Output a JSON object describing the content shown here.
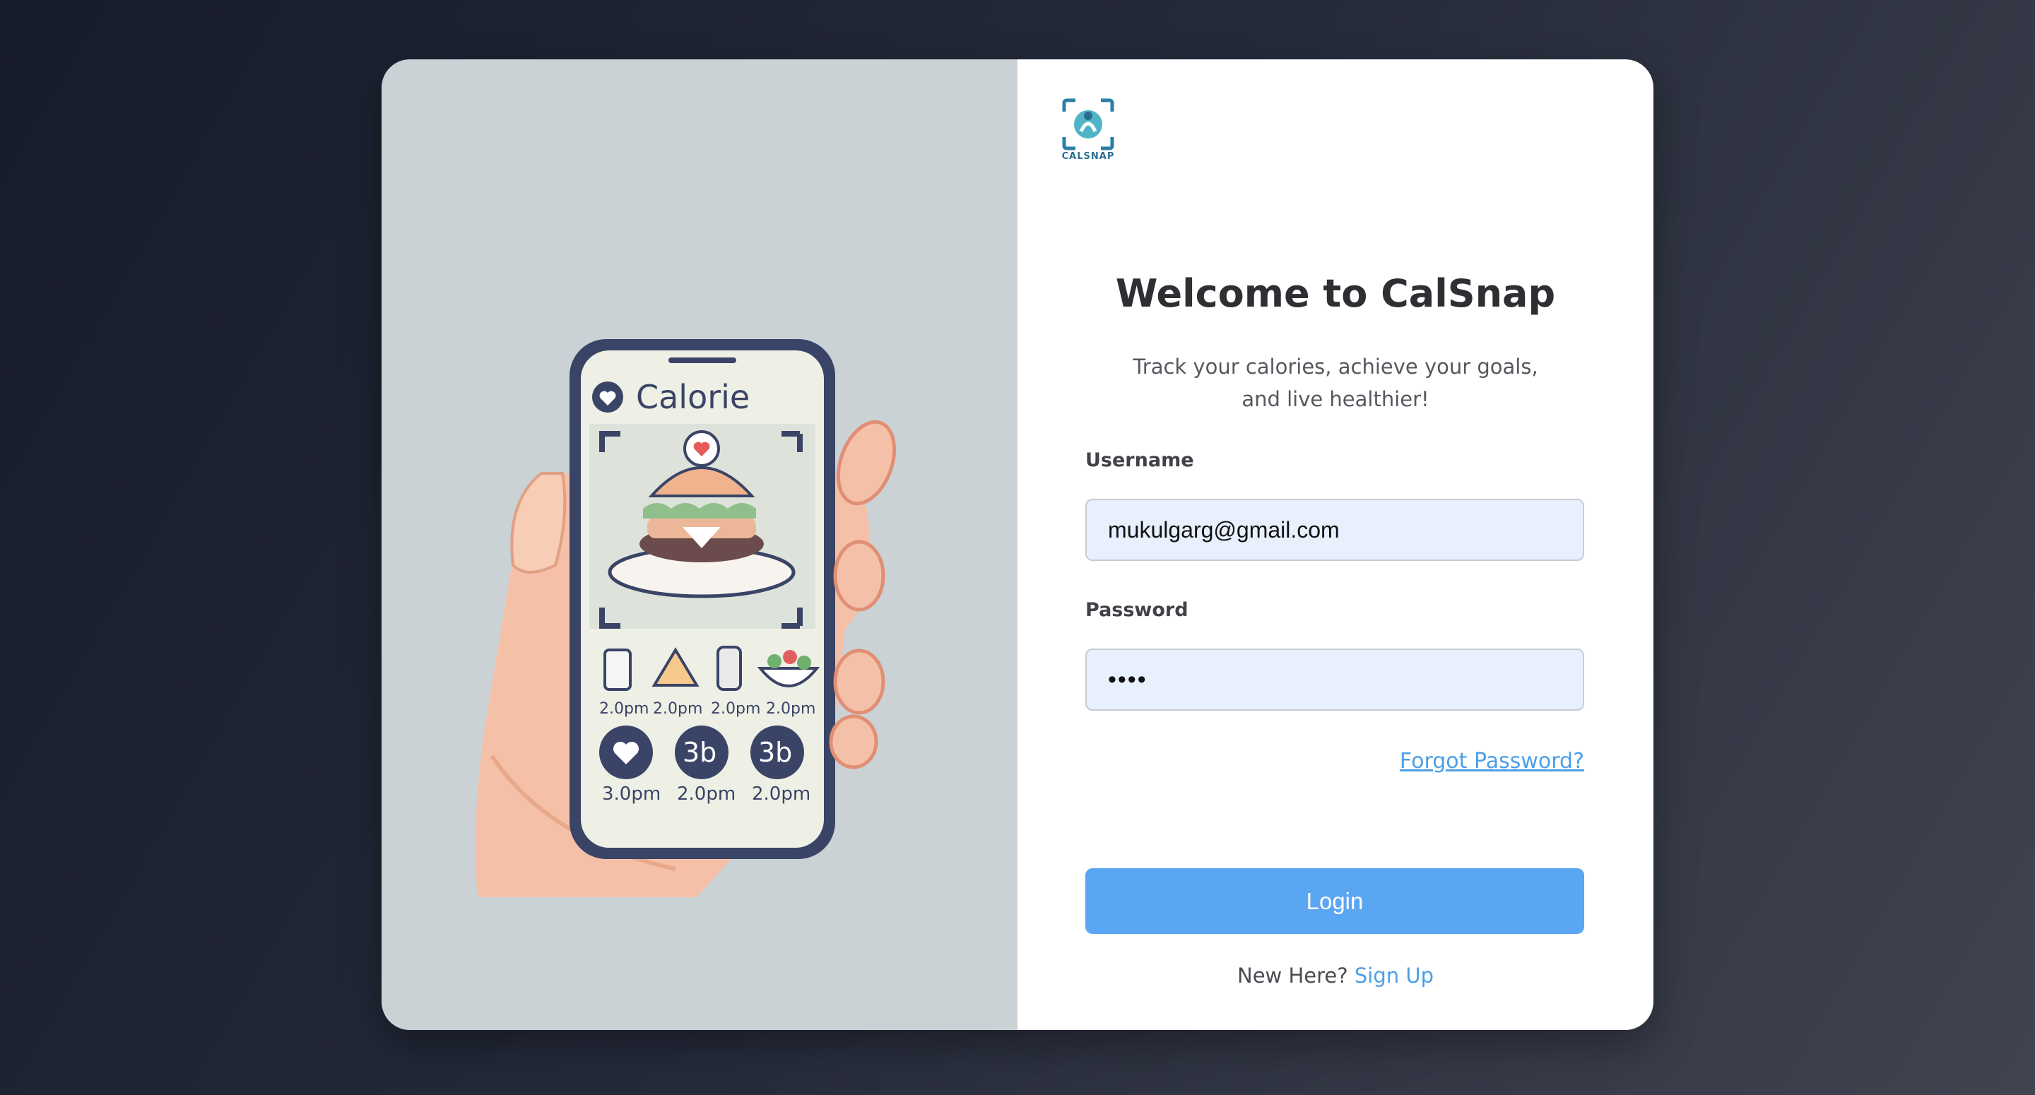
{
  "brand": {
    "logo_text": "CALSNAP"
  },
  "illustration": {
    "screen_title": "Calorie",
    "food_labels": [
      "2.0pm",
      "2.0pm",
      "2.0pm",
      "2.0pm"
    ],
    "badge_labels": [
      "",
      "3b",
      "3b"
    ],
    "badge_times": [
      "3.0pm",
      "2.0pm",
      "2.0pm"
    ]
  },
  "login": {
    "title": "Welcome to CalSnap",
    "subtitle": "Track your calories, achieve your goals, and live healthier!",
    "username_label": "Username",
    "username_value": "mukulgarg@gmail.com",
    "password_label": "Password",
    "password_value": "••••",
    "forgot_label": "Forgot Password?",
    "login_label": "Login",
    "new_here_text": "New Here?",
    "signup_label": "Sign Up"
  },
  "colors": {
    "accent": "#5ba6f2",
    "link": "#4d9fe6",
    "left_pane": "#cbd2d6"
  }
}
